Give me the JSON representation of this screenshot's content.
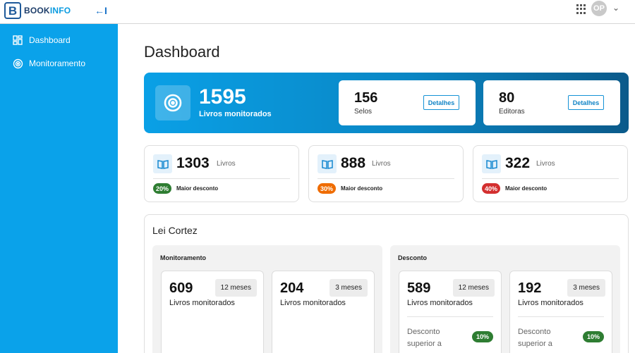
{
  "brand": {
    "logo_letter": "B",
    "name_part1": "BOOK",
    "name_part2": "INFO"
  },
  "topbar": {
    "collapse_symbol": "←I",
    "avatar_initials": "OP",
    "caret": "⌄"
  },
  "sidebar": {
    "items": [
      {
        "label": "Dashboard",
        "icon": "grid-icon"
      },
      {
        "label": "Monitoramento",
        "icon": "target-icon"
      }
    ]
  },
  "page": {
    "title": "Dashboard"
  },
  "hero": {
    "value": "1595",
    "label": "Livros monitorados",
    "cards": [
      {
        "value": "156",
        "label": "Selos",
        "button": "Detalhes"
      },
      {
        "value": "80",
        "label": "Editoras",
        "button": "Detalhes"
      }
    ]
  },
  "stats": [
    {
      "value": "1303",
      "unit": "Livros",
      "discount": "20%",
      "discount_label": "Maior desconto",
      "color": "#2e7d32"
    },
    {
      "value": "888",
      "unit": "Livros",
      "discount": "30%",
      "discount_label": "Maior desconto",
      "color": "#ef6c00"
    },
    {
      "value": "322",
      "unit": "Livros",
      "discount": "40%",
      "discount_label": "Maior desconto",
      "color": "#d32f2f"
    }
  ],
  "law_panel": {
    "title": "Lei Cortez",
    "sections": [
      {
        "title": "Monitoramento",
        "cards": [
          {
            "value": "609",
            "period": "12 meses",
            "label": "Livros monitorados"
          },
          {
            "value": "204",
            "period": "3 meses",
            "label": "Livros monitorados"
          }
        ]
      },
      {
        "title": "Desconto",
        "cards": [
          {
            "value": "589",
            "period": "12 meses",
            "label": "Livros monitorados",
            "desc": "Desconto superior a",
            "pill": "10%"
          },
          {
            "value": "192",
            "period": "3 meses",
            "label": "Livros monitorados",
            "desc": "Desconto superior a",
            "pill": "10%"
          }
        ]
      }
    ]
  }
}
